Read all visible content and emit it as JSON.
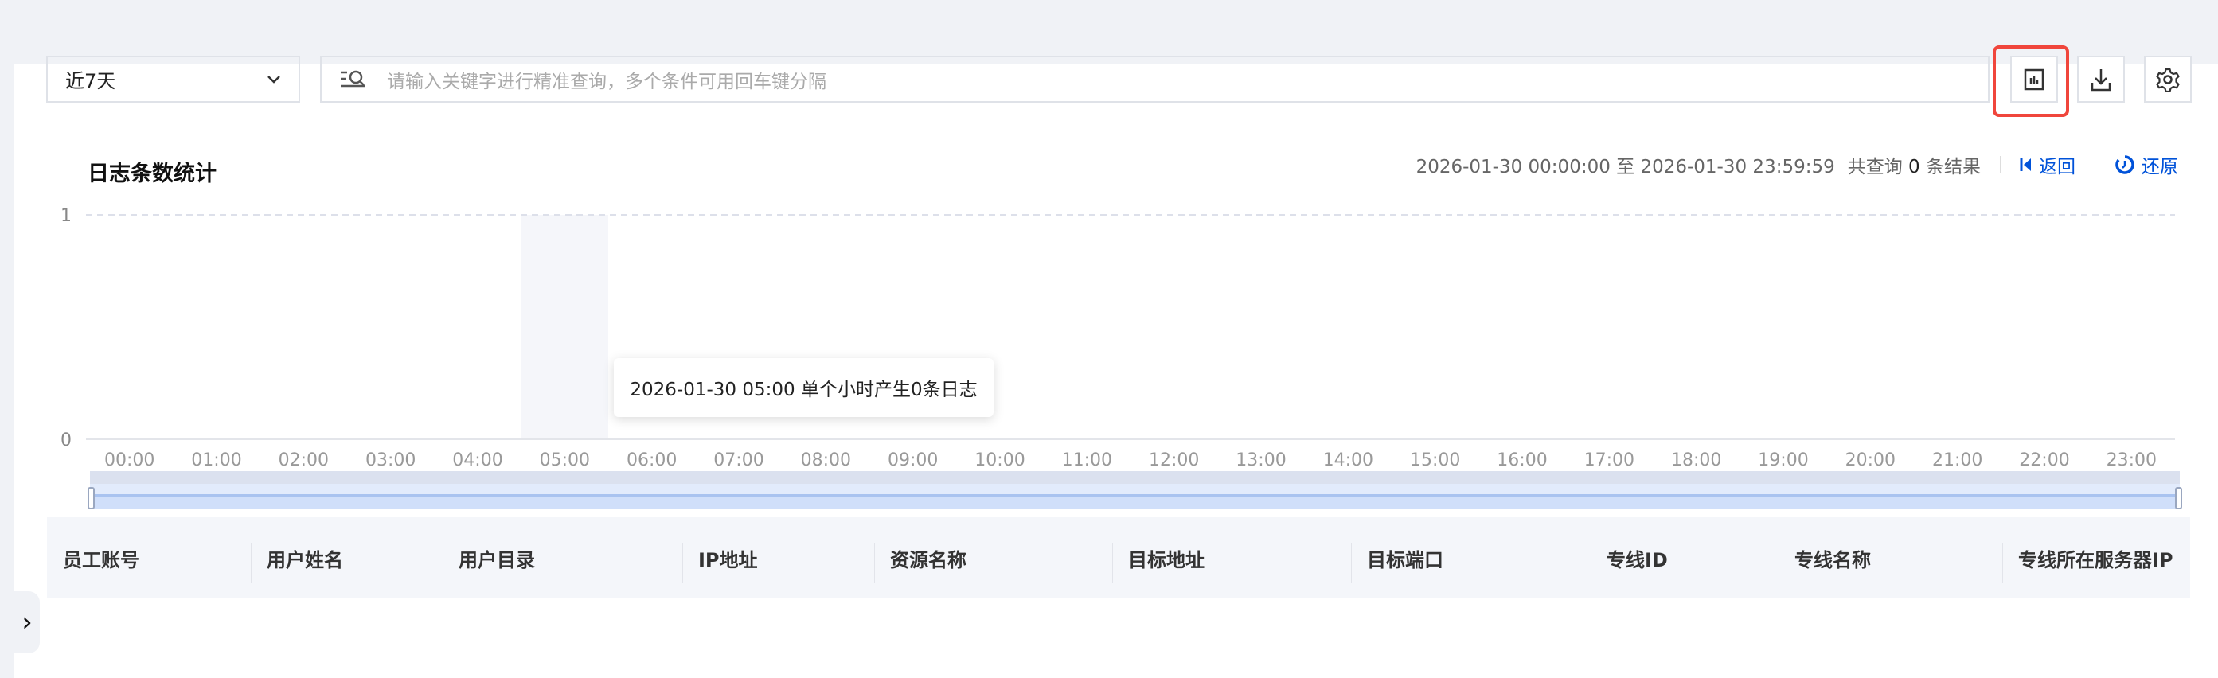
{
  "filters": {
    "time_range": "近7天",
    "search_placeholder": "请输入关键字进行精准查询，多个条件可用回车键分隔"
  },
  "toolbar": {
    "icons": [
      "bar-chart-icon",
      "download-icon",
      "gear-icon"
    ],
    "highlight_color": "#f0463c"
  },
  "stats": {
    "title": "日志条数统计",
    "range_text": "2026-01-30 00:00:00 至 2026-01-30 23:59:59",
    "count_prefix": "共查询",
    "count": "0",
    "count_suffix": "条结果",
    "back_label": "返回",
    "reset_label": "还原",
    "link_color": "#0052d9"
  },
  "chart_data": {
    "type": "bar",
    "categories": [
      "00:00",
      "01:00",
      "02:00",
      "03:00",
      "04:00",
      "05:00",
      "06:00",
      "07:00",
      "08:00",
      "09:00",
      "10:00",
      "11:00",
      "12:00",
      "13:00",
      "14:00",
      "15:00",
      "16:00",
      "17:00",
      "18:00",
      "19:00",
      "20:00",
      "21:00",
      "22:00",
      "23:00"
    ],
    "values": [
      0,
      0,
      0,
      0,
      0,
      0,
      0,
      0,
      0,
      0,
      0,
      0,
      0,
      0,
      0,
      0,
      0,
      0,
      0,
      0,
      0,
      0,
      0,
      0
    ],
    "yticks": [
      "0",
      "1"
    ],
    "ylim": [
      0,
      1
    ],
    "hovered_category": "05:00",
    "tooltip": "2026-01-30 05:00 单个小时产生0条日志"
  },
  "table": {
    "columns": [
      "员工账号",
      "用户姓名",
      "用户目录",
      "IP地址",
      "资源名称",
      "目标地址",
      "目标端口",
      "专线ID",
      "专线名称",
      "专线所在服务器IP"
    ]
  }
}
